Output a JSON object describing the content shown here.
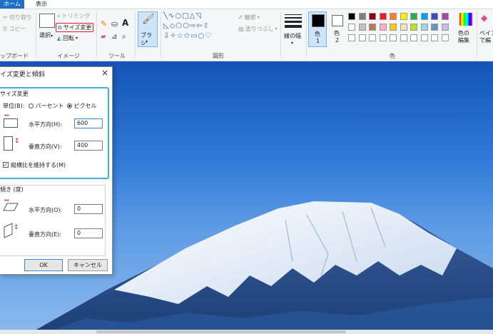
{
  "menu": {
    "home": "ホーム",
    "view": "表示"
  },
  "ribbon": {
    "clipboard": {
      "cut": "切り取り",
      "copy": "コピー",
      "label": "ップボード"
    },
    "image": {
      "select": "選択",
      "crop": "トリミング",
      "resize": "サイズ変更",
      "rotate": "回転",
      "label": "イメージ"
    },
    "tools": {
      "label": "ツール"
    },
    "brush": {
      "label": "ブラシ"
    },
    "shapes": {
      "outline": "輪郭",
      "fill": "塗りつぶし",
      "label": "図形"
    },
    "size": {
      "label": "線の幅"
    },
    "color1": {
      "label": "色",
      "num": "1"
    },
    "color2": {
      "label": "色",
      "num": "2"
    },
    "colors": {
      "label": "色",
      "edit": "色の\n編集",
      "paint3d": "ペイン\nで編"
    },
    "palette_row1": [
      "#000000",
      "#7f7f7f",
      "#880015",
      "#ed1c24",
      "#ff7f27",
      "#fff200",
      "#22b14c",
      "#00a2e8",
      "#3f48cc",
      "#a349a4"
    ],
    "palette_row2": [
      "#ffffff",
      "#c3c3c3",
      "#b97a57",
      "#ffaec9",
      "#ffc90e",
      "#efe4b0",
      "#b5e61d",
      "#99d9ea",
      "#7092be",
      "#c8bfe7"
    ]
  },
  "dialog": {
    "title": "イズ変更と傾斜",
    "resize_section": "サイズ変更",
    "unit_label": "単位(B):",
    "percent": "パーセント",
    "pixel": "ピクセル",
    "horizontal_label": "水平方向(H):",
    "horizontal_value": "600",
    "vertical_label": "垂直方向(V):",
    "vertical_value": "400",
    "keep_ratio": "縦横比を維持する(M)",
    "skew_section": "傾き (度)",
    "skew_h_label": "水平方向(O):",
    "skew_h_value": "0",
    "skew_v_label": "垂直方向(E):",
    "skew_v_value": "0",
    "ok": "OK",
    "cancel": "キャンセル"
  }
}
